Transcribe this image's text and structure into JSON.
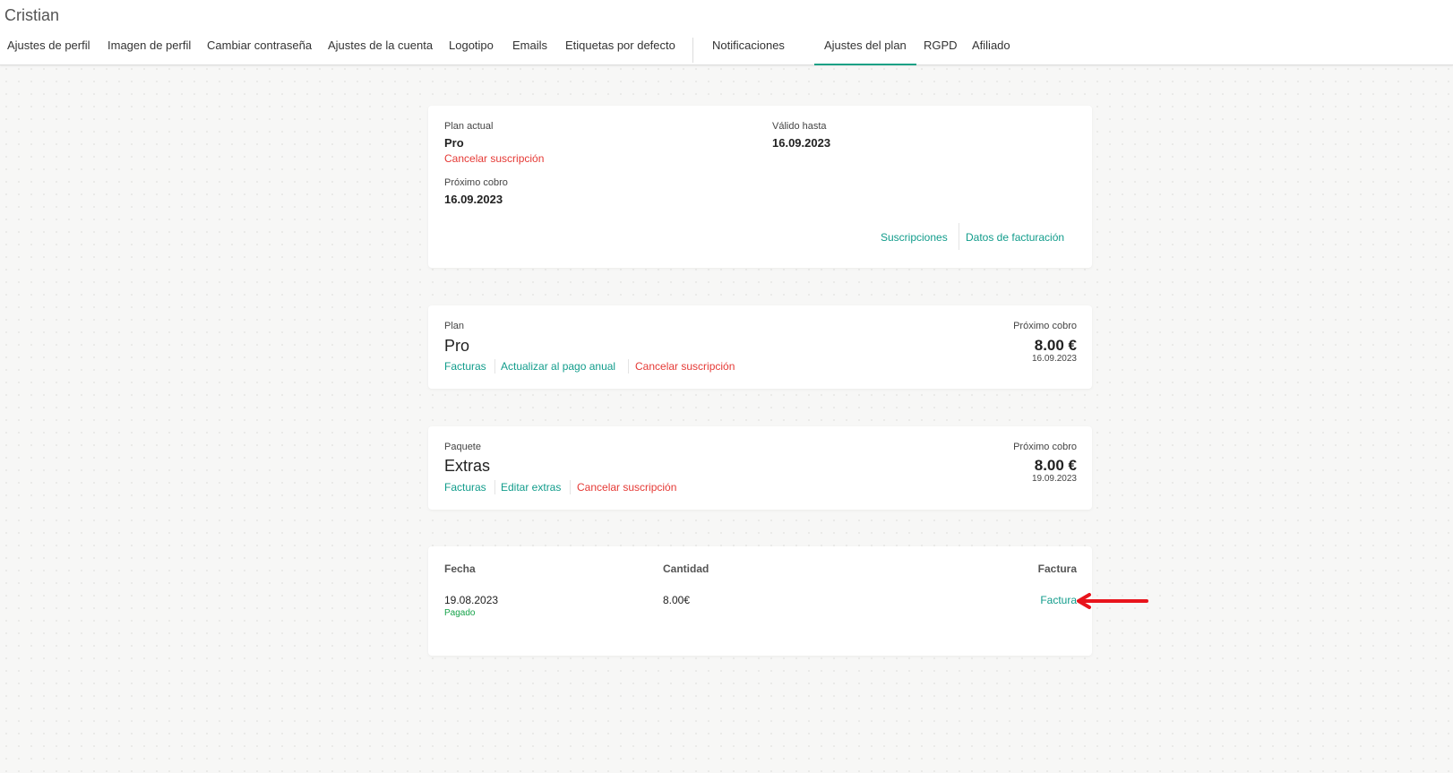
{
  "header": {
    "user_name": "Cristian",
    "tabs": [
      {
        "label": "Ajustes de perfil"
      },
      {
        "label": "Imagen de perfil"
      },
      {
        "label": "Cambiar contraseña"
      },
      {
        "label": "Ajustes de la cuenta"
      },
      {
        "label": "Logotipo"
      },
      {
        "label": "Emails"
      },
      {
        "label": "Etiquetas por defecto"
      },
      {
        "label": "Notificaciones"
      },
      {
        "label": "Ajustes del plan",
        "active": true
      },
      {
        "label": "RGPD"
      },
      {
        "label": "Afiliado"
      }
    ]
  },
  "current_plan": {
    "plan_label": "Plan actual",
    "plan_value": "Pro",
    "cancel_label": "Cancelar suscripción",
    "valid_label": "Válido hasta",
    "valid_value": "16.09.2023",
    "next_label": "Próximo cobro",
    "next_value": "16.09.2023",
    "subscriptions_link": "Suscripciones",
    "billing_link": "Datos de facturación"
  },
  "plan_card": {
    "label": "Plan",
    "name": "Pro",
    "invoices_link": "Facturas",
    "upgrade_link": "Actualizar al pago anual",
    "cancel_link": "Cancelar suscripción",
    "next_label": "Próximo cobro",
    "amount": "8.00 €",
    "date": "16.09.2023"
  },
  "package_card": {
    "label": "Paquete",
    "name": "Extras",
    "invoices_link": "Facturas",
    "edit_link": "Editar extras",
    "cancel_link": "Cancelar suscripción",
    "next_label": "Próximo cobro",
    "amount": "8.00 €",
    "date": "19.09.2023"
  },
  "invoices_table": {
    "headers": {
      "date": "Fecha",
      "amount": "Cantidad",
      "invoice": "Factura"
    },
    "rows": [
      {
        "date": "19.08.2023",
        "status": "Pagado",
        "amount": "8.00€",
        "invoice": "Factura"
      }
    ]
  },
  "colors": {
    "accent_teal": "#119c8b",
    "danger_red": "#e53935",
    "paid_green": "#16a34a",
    "annotation_arrow": "#e8141c"
  }
}
